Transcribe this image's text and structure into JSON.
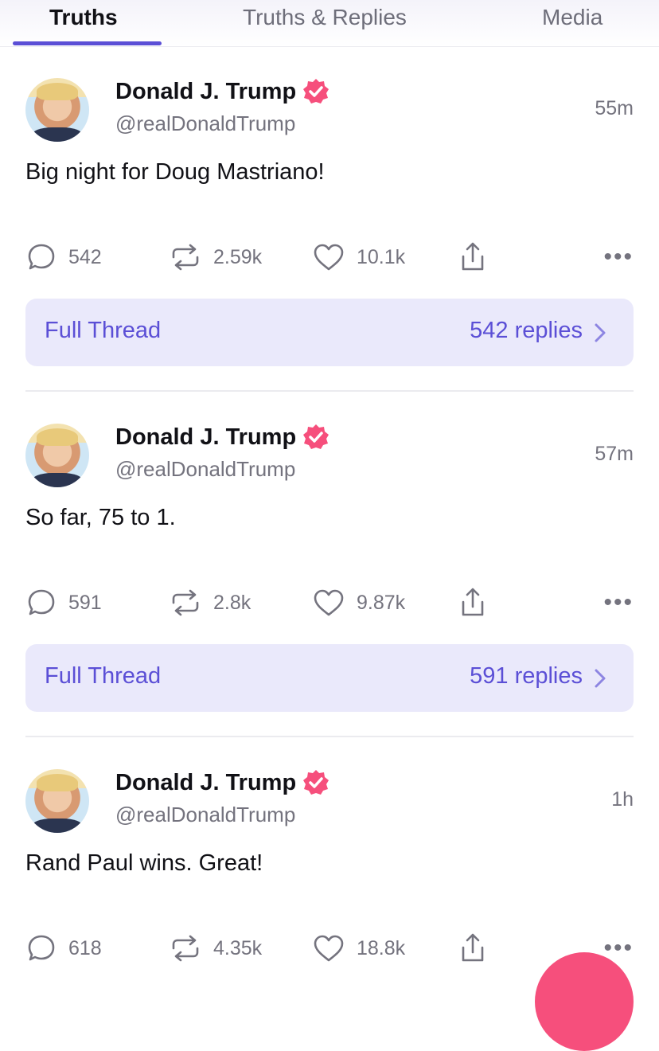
{
  "tabs": [
    {
      "label": "Truths",
      "active": true
    },
    {
      "label": "Truths & Replies",
      "active": false
    },
    {
      "label": "Media",
      "active": false
    }
  ],
  "colors": {
    "accent": "#5b4fd6",
    "verified": "#f64f7c",
    "thread_bg": "#eae9fb"
  },
  "posts": [
    {
      "name": "Donald J. Trump",
      "handle": "@realDonaldTrump",
      "time": "55m",
      "text": "Big night for Doug Mastriano!",
      "replies": "542",
      "retruths": "2.59k",
      "likes": "10.1k",
      "thread_label": "Full Thread",
      "thread_replies": "542 replies"
    },
    {
      "name": "Donald J. Trump",
      "handle": "@realDonaldTrump",
      "time": "57m",
      "text": "So far, 75 to 1.",
      "replies": "591",
      "retruths": "2.8k",
      "likes": "9.87k",
      "thread_label": "Full Thread",
      "thread_replies": "591 replies"
    },
    {
      "name": "Donald J. Trump",
      "handle": "@realDonaldTrump",
      "time": "1h",
      "text": "Rand Paul wins. Great!",
      "replies": "618",
      "retruths": "4.35k",
      "likes": "18.8k"
    }
  ],
  "icons": {
    "reply": "reply-icon",
    "retruth": "retruth-icon",
    "like": "heart-icon",
    "share": "share-icon",
    "more": "more-icon",
    "verified": "verified-badge-icon"
  }
}
